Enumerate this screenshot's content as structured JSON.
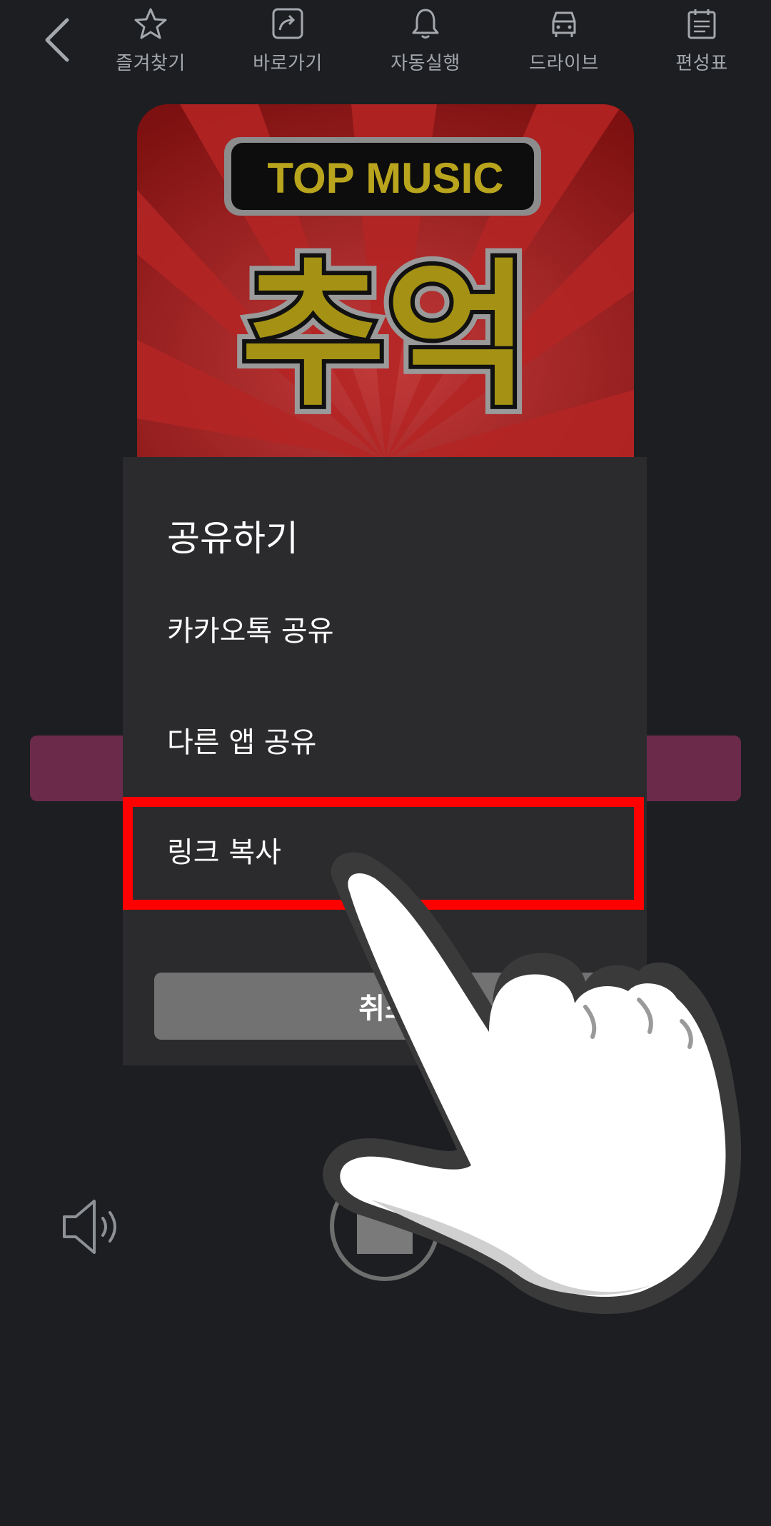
{
  "topbar": {
    "items": [
      {
        "label": "즐겨찾기",
        "icon": "star-icon"
      },
      {
        "label": "바로가기",
        "icon": "share-arrow-icon"
      },
      {
        "label": "자동실행",
        "icon": "bell-icon"
      },
      {
        "label": "드라이브",
        "icon": "car-icon"
      },
      {
        "label": "편성표",
        "icon": "schedule-icon"
      }
    ]
  },
  "album": {
    "badge": "TOP MUSIC",
    "title": "추억"
  },
  "dialog": {
    "title": "공유하기",
    "options": [
      {
        "label": "카카오톡 공유"
      },
      {
        "label": "다른 앱 공유"
      },
      {
        "label": "링크 복사"
      }
    ],
    "cancel_label": "취소"
  },
  "colors": {
    "background": "#1c1e21",
    "dialog": "#2b2b2d",
    "highlight": "#ff0000",
    "accent_bar": "#6c2a4b",
    "cancel_button": "#727272"
  }
}
